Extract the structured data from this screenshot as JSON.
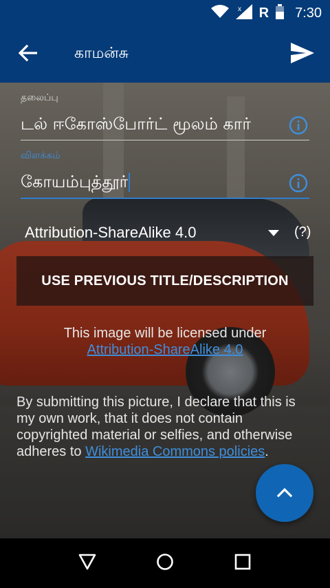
{
  "status_bar": {
    "time": "7:30",
    "network_label": "R",
    "icons": [
      "wifi-icon",
      "signal-icon",
      "battery-icon"
    ]
  },
  "app_bar": {
    "title": "காமன்சு",
    "back_icon": "arrow-back-icon",
    "send_icon": "send-icon",
    "color": "#053b78"
  },
  "form": {
    "title_label": "தலைப்பு",
    "title_value": "டல் ஈகோஸ்போர்ட் மூலம் கார்",
    "description_label": "விளக்கம்",
    "description_value": "கோயம்புத்தூர்",
    "info_icon": "info-icon"
  },
  "license": {
    "selected": "Attribution-ShareAlike 4.0",
    "help_label": "(?)"
  },
  "buttons": {
    "previous": "USE PREVIOUS TITLE/DESCRIPTION"
  },
  "license_notice": {
    "text": "This image will be licensed under",
    "link": "Attribution-ShareAlike 4.0"
  },
  "declaration": {
    "text": "By submitting this picture, I declare that this is my own work, that it does not contain copyrighted material or selfies, and otherwise adheres to",
    "link": "Wikimedia Commons policies",
    "suffix": "."
  },
  "fab": {
    "icon": "chevron-up-icon",
    "color": "#1066b4"
  },
  "nav_bar": {
    "icons": [
      "back-triangle-icon",
      "home-circle-icon",
      "recents-square-icon"
    ]
  },
  "colors": {
    "accent": "#2c7fd0",
    "link": "#3f8fdc"
  }
}
